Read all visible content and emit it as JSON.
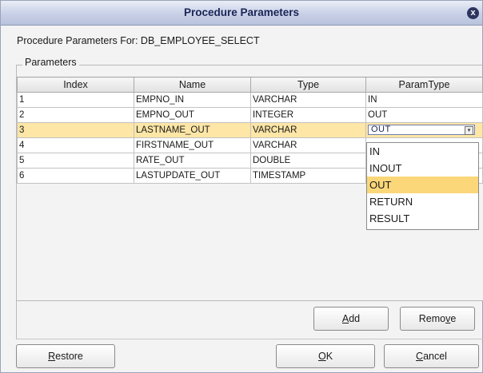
{
  "window": {
    "title": "Procedure Parameters",
    "close_glyph": "x"
  },
  "procedure_label": "Procedure Parameters For:  DB_EMPLOYEE_SELECT",
  "group_title": "Parameters",
  "table": {
    "headers": [
      "Index",
      "Name",
      "Type",
      "ParamType"
    ],
    "rows": [
      {
        "index": "1",
        "name": "EMPNO_IN",
        "type": "VARCHAR",
        "param_type": "IN"
      },
      {
        "index": "2",
        "name": "EMPNO_OUT",
        "type": "INTEGER",
        "param_type": "OUT"
      },
      {
        "index": "3",
        "name": "LASTNAME_OUT",
        "type": "VARCHAR",
        "param_type": "OUT"
      },
      {
        "index": "4",
        "name": "FIRSTNAME_OUT",
        "type": "VARCHAR",
        "param_type": ""
      },
      {
        "index": "5",
        "name": "RATE_OUT",
        "type": "DOUBLE",
        "param_type": ""
      },
      {
        "index": "6",
        "name": "LASTUPDATE_OUT",
        "type": "TIMESTAMP",
        "param_type": ""
      }
    ],
    "selected_row_index": 3
  },
  "dropdown": {
    "selected": "OUT",
    "options": [
      "IN",
      "INOUT",
      "OUT",
      "RETURN",
      "RESULT"
    ]
  },
  "buttons": {
    "add": {
      "mnemonic": "A",
      "rest": "dd"
    },
    "remove": {
      "prefix": "Remo",
      "mnemonic": "v",
      "rest": "e"
    },
    "restore": {
      "mnemonic": "R",
      "rest": "estore"
    },
    "ok": {
      "mnemonic": "O",
      "rest": "K"
    },
    "cancel": {
      "mnemonic": "C",
      "rest": "ancel"
    }
  },
  "colors": {
    "title_text": "#1b2456",
    "selected_row": "#fde6a6",
    "highlighted_option": "#fbd77a"
  }
}
